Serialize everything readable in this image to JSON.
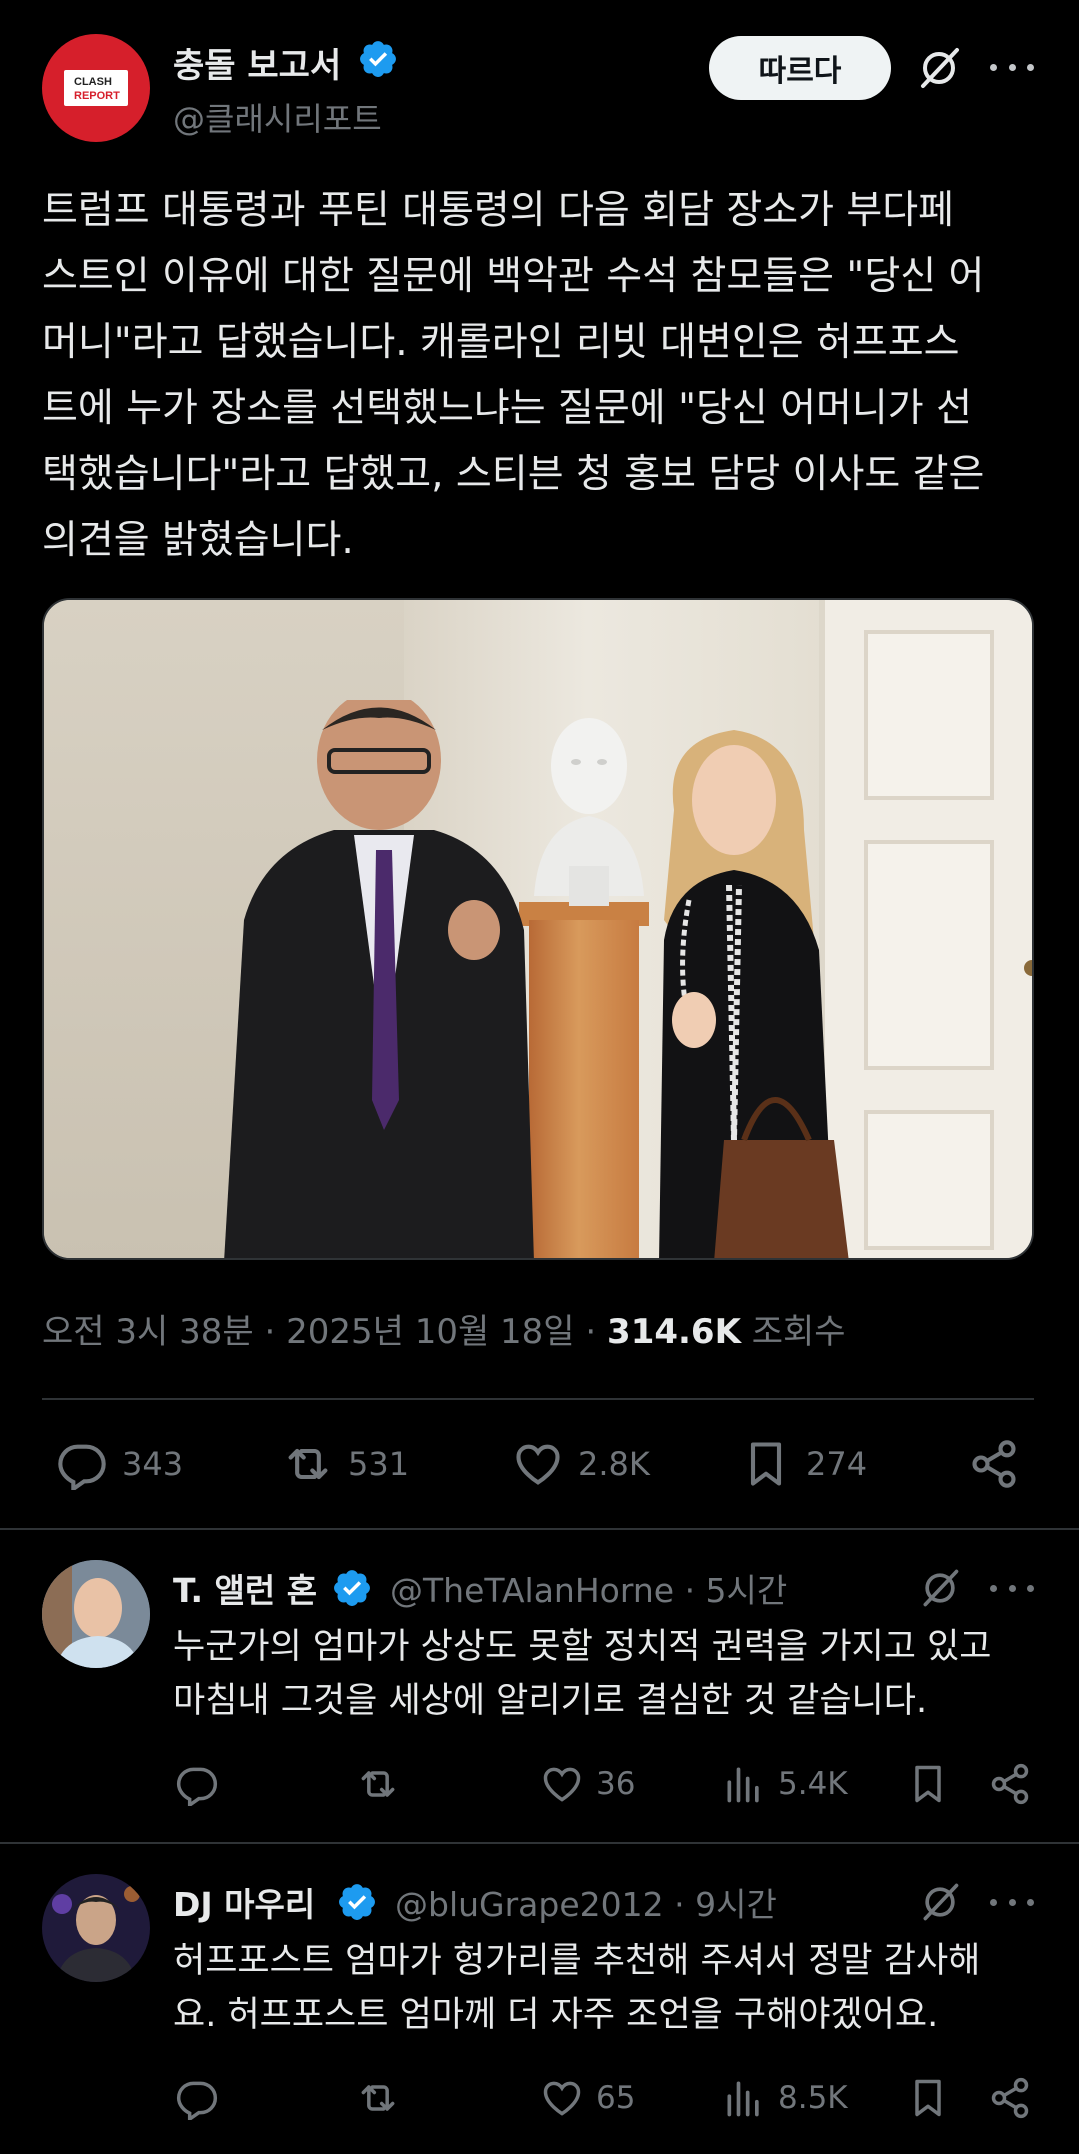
{
  "tweet": {
    "author": {
      "display_name": "충돌 보고서",
      "handle": "@클래시리포트",
      "avatar_text_line1": "CLASH",
      "avatar_text_line2": "REPORT",
      "verified": true
    },
    "follow_label": "따르다",
    "text": "트럼프 대통령과 푸틴 대통령의 다음 회담 장소가 부다페\n스트인 이유에 대한 질문에 백악관 수석 참모들은 \"당신 어\n머니\"라고 답했습니다. 캐롤라인 리빗 대변인은 허프포스\n트에 누가 장소를 선택했느냐는 질문에 \"당신 어머니가 선\n택했습니다\"라고 답했고, 스티븐 청 홍보 담당 이사도 같은\n의견을 밝혔습니다.",
    "meta": {
      "time": "오전 3시 38분",
      "separator": "·",
      "date": "2025년 10월 18일",
      "views": "314.6K",
      "views_label": "조회수"
    },
    "stats": {
      "replies": "343",
      "reposts": "531",
      "likes": "2.8K",
      "bookmarks": "274"
    }
  },
  "replies": [
    {
      "display_name": "T. 앨런 혼",
      "handle": "@TheTAlanHorne",
      "time": "· 5시간",
      "text": "누군가의 엄마가 상상도 못할 정치적 권력을 가지고 있고\n마침내 그것을 세상에 알리기로 결심한 것 같습니다.",
      "likes": "36",
      "views": "5.4K"
    },
    {
      "display_name": "DJ 마우리",
      "handle": "@bluGrape2012",
      "time": "· 9시간",
      "text": "허프포스트 엄마가 헝가리를 추천해 주셔서 정말 감사해\n요. 허프포스트 엄마께 더 자주 조언을 구해야겠어요.",
      "likes": "65",
      "views": "8.5K"
    }
  ],
  "colors": {
    "background": "#000000",
    "text": "#e7e9ea",
    "muted": "#71767b",
    "verified": "#1d9bf0",
    "divider": "#2f3336"
  },
  "icons": [
    "verified-badge-icon",
    "grok-icon",
    "more-icon",
    "reply-icon",
    "repost-icon",
    "like-icon",
    "bookmark-icon",
    "share-icon",
    "views-icon"
  ]
}
